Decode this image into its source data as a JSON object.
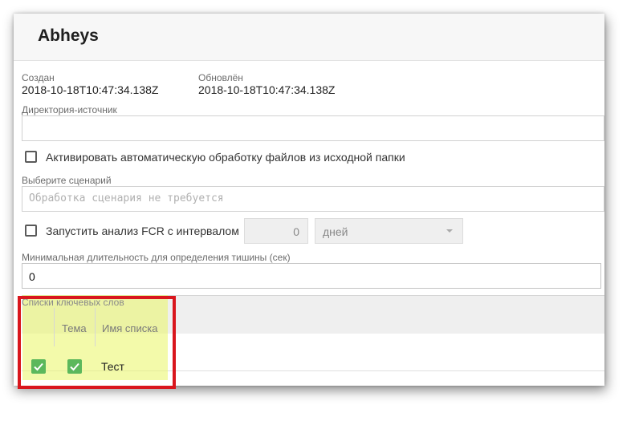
{
  "header": {
    "title": "Abheys"
  },
  "meta": {
    "created_label": "Создан",
    "created_value": "2018-10-18T10:47:34.138Z",
    "updated_label": "Обновлён",
    "updated_value": "2018-10-18T10:47:34.138Z"
  },
  "source_dir": {
    "label": "Директория-источник",
    "value": ""
  },
  "auto_process": {
    "label": "Активировать автоматическую обработку файлов из исходной папки",
    "checked": false
  },
  "scenario": {
    "label": "Выберите сценарий",
    "placeholder": "Обработка сценария не требуется"
  },
  "fcr": {
    "label": "Запустить анализ FCR с интервалом",
    "checked": false,
    "interval_value": "0",
    "unit_selected": "дней"
  },
  "silence": {
    "label": "Минимальная длительность для определения тишины (сек)",
    "value": "0"
  },
  "keywords": {
    "section_label": "Списки ключевых слов",
    "columns": [
      "",
      "Тема",
      "Имя списка"
    ],
    "rows": [
      {
        "selected": true,
        "theme": true,
        "name": "Тест"
      }
    ]
  },
  "colors": {
    "highlight": "#e9f564",
    "annotation": "#d9161d",
    "check": "#5cb85c"
  },
  "icons": {
    "checkbox": "checkbox-icon",
    "check": "check-icon",
    "dropdown": "chevron-down-icon"
  }
}
